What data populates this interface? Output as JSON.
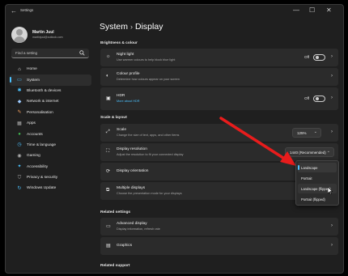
{
  "window": {
    "title": "Settings",
    "back_glyph": "←",
    "minimize": "—",
    "maximize": "☐",
    "close": "✕"
  },
  "profile": {
    "name": "Martin Juul",
    "email": "martinjuul@outlook.com"
  },
  "search": {
    "placeholder": "Find a setting",
    "icon": "search-icon"
  },
  "sidebar": {
    "items": [
      {
        "label": "Home",
        "icon": "home-icon",
        "glyph": "⌂",
        "color": "#e8e8e8"
      },
      {
        "label": "System",
        "icon": "monitor-icon",
        "glyph": "▭",
        "color": "#4cc2ff",
        "selected": true
      },
      {
        "label": "Bluetooth & devices",
        "icon": "bluetooth-icon",
        "glyph": "✱",
        "color": "#4cc2ff"
      },
      {
        "label": "Network & internet",
        "icon": "wifi-icon",
        "glyph": "◆",
        "color": "#9ecbff"
      },
      {
        "label": "Personalisation",
        "icon": "brush-icon",
        "glyph": "✎",
        "color": "#f0a060"
      },
      {
        "label": "Apps",
        "icon": "apps-icon",
        "glyph": "▦",
        "color": "#b0b0b0"
      },
      {
        "label": "Accounts",
        "icon": "person-icon",
        "glyph": "●",
        "color": "#3fb950"
      },
      {
        "label": "Time & language",
        "icon": "clock-globe-icon",
        "glyph": "◷",
        "color": "#4cc2ff"
      },
      {
        "label": "Gaming",
        "icon": "controller-icon",
        "glyph": "◉",
        "color": "#b0b0b0"
      },
      {
        "label": "Accessibility",
        "icon": "accessibility-icon",
        "glyph": "✦",
        "color": "#4cc2ff"
      },
      {
        "label": "Privacy & security",
        "icon": "shield-icon",
        "glyph": "⛉",
        "color": "#b0b0b0"
      },
      {
        "label": "Windows Update",
        "icon": "update-icon",
        "glyph": "↻",
        "color": "#4cc2ff"
      }
    ]
  },
  "breadcrumb": {
    "parent": "System",
    "separator": "›",
    "current": "Display"
  },
  "sections": {
    "brightness": "Brightness & colour",
    "scale_layout": "Scale & layout",
    "related_settings": "Related settings",
    "related_support": "Related support"
  },
  "cards": {
    "night_light": {
      "title": "Night light",
      "desc": "Use warmer colours to help block blue light",
      "value": "Off"
    },
    "colour_profile": {
      "title": "Colour profile",
      "desc": "Determine how colours appear on your screen"
    },
    "hdr": {
      "title": "HDR",
      "link": "More about HDR",
      "value": "Off"
    },
    "scale": {
      "title": "Scale",
      "desc": "Change the size of text, apps, and other items",
      "value": "125%"
    },
    "resolution": {
      "title": "Display resolution",
      "desc": "Adjust the resolution to fit your connected display",
      "value": "1440 (Recommended)"
    },
    "orientation": {
      "title": "Display orientation"
    },
    "multiple": {
      "title": "Multiple displays",
      "desc": "Choose the presentation mode for your displays"
    },
    "advanced": {
      "title": "Advanced display",
      "desc": "Display information, refresh rate"
    },
    "graphics": {
      "title": "Graphics"
    }
  },
  "orientation_menu": {
    "options": [
      "Landscape",
      "Portrait",
      "Landscape (flipped)",
      "Portrait (flipped)"
    ],
    "selected": "Landscape"
  },
  "colors": {
    "accent": "#4cc2ff",
    "annotation_arrow": "#e81c1c",
    "background": "#1f1f1f",
    "card": "#2b2b2b"
  }
}
